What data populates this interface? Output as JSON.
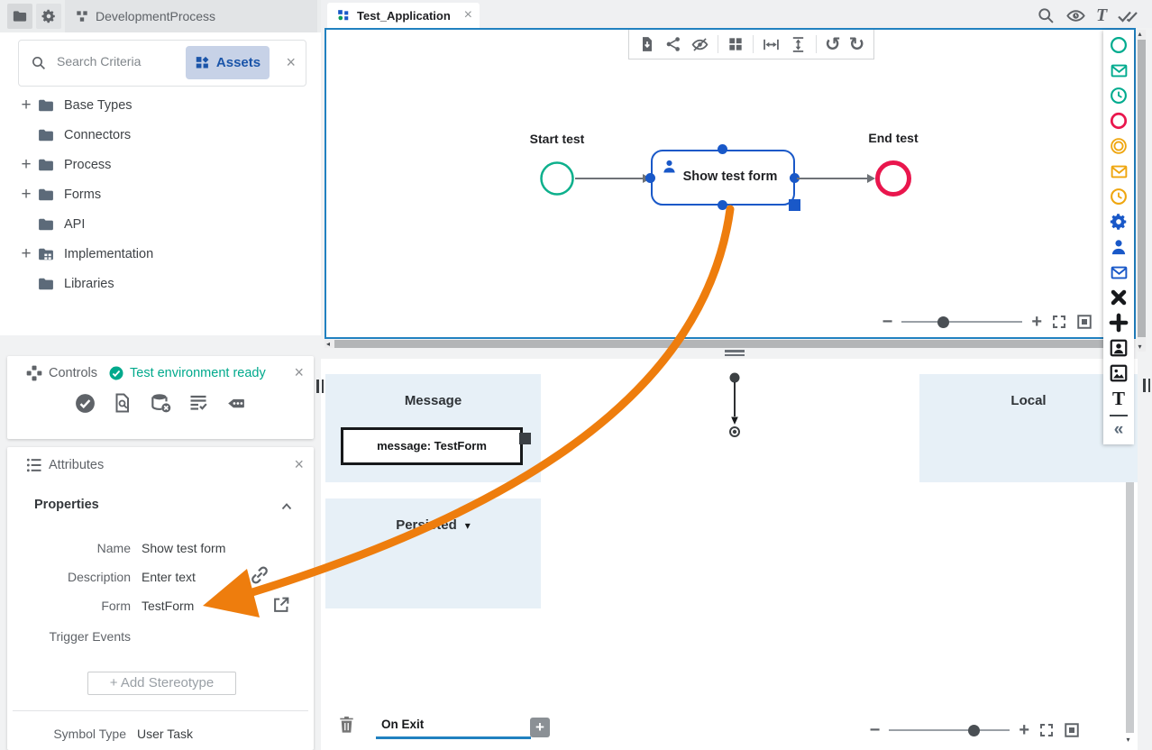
{
  "topbar": {
    "project": "DevelopmentProcess"
  },
  "sidebar": {
    "search_placeholder": "Search Criteria",
    "assets_label": "Assets",
    "tree": [
      {
        "label": "Base Types",
        "expand": "+"
      },
      {
        "label": "Connectors",
        "expand": ""
      },
      {
        "label": "Process",
        "expand": "+"
      },
      {
        "label": "Forms",
        "expand": "+"
      },
      {
        "label": "API",
        "expand": ""
      },
      {
        "label": "Implementation",
        "expand": "+"
      },
      {
        "label": "Libraries",
        "expand": ""
      }
    ]
  },
  "controls": {
    "title": "Controls",
    "status": "Test environment ready"
  },
  "attributes": {
    "title": "Attributes",
    "section_title": "Properties",
    "name_label": "Name",
    "name_value": "Show test form",
    "description_label": "Description",
    "description_value": "Enter text",
    "form_label": "Form",
    "form_value": "TestForm",
    "trigger_events_label": "Trigger Events",
    "add_stereotype_label": "+ Add Stereotype",
    "symbol_type_label": "Symbol Type",
    "symbol_type_value": "User Task"
  },
  "editor": {
    "tab_label": "Test_Application",
    "diagram": {
      "start_label": "Start test",
      "task_label": "Show test form",
      "end_label": "End test"
    },
    "lower": {
      "message_title": "Message",
      "message_box_label": "message: TestForm",
      "persisted_title": "Persisted",
      "local_title": "Local",
      "on_exit_value": "On Exit"
    }
  },
  "icons": {
    "close": "×",
    "undo": "↺",
    "redo": "↻",
    "collapse": "«",
    "zoom_in": "+",
    "zoom_out": "−",
    "add": "+",
    "dropdown_caret": "▾",
    "scroll_up": "▴",
    "scroll_down": "▾",
    "scroll_left": "◂",
    "text_tool": "T"
  },
  "palette_icons": [
    "start-event-circle",
    "message-start-event",
    "timer-start-event",
    "end-event-circle",
    "intermediate-event",
    "message-intermediate-event",
    "timer-intermediate-event",
    "service-task-gear",
    "user-task",
    "message-task",
    "exclusive-gateway-x",
    "parallel-gateway-plus",
    "user-image",
    "image",
    "text",
    "collapse-palette"
  ],
  "colors": {
    "teal": "#00ab8e",
    "red": "#e9164d",
    "orange": "#efa60f",
    "blue": "#1958c8",
    "arrow": "#ee7d0d",
    "panel_blue": "#e7f0f7",
    "canvas_border": "#2181c0"
  }
}
